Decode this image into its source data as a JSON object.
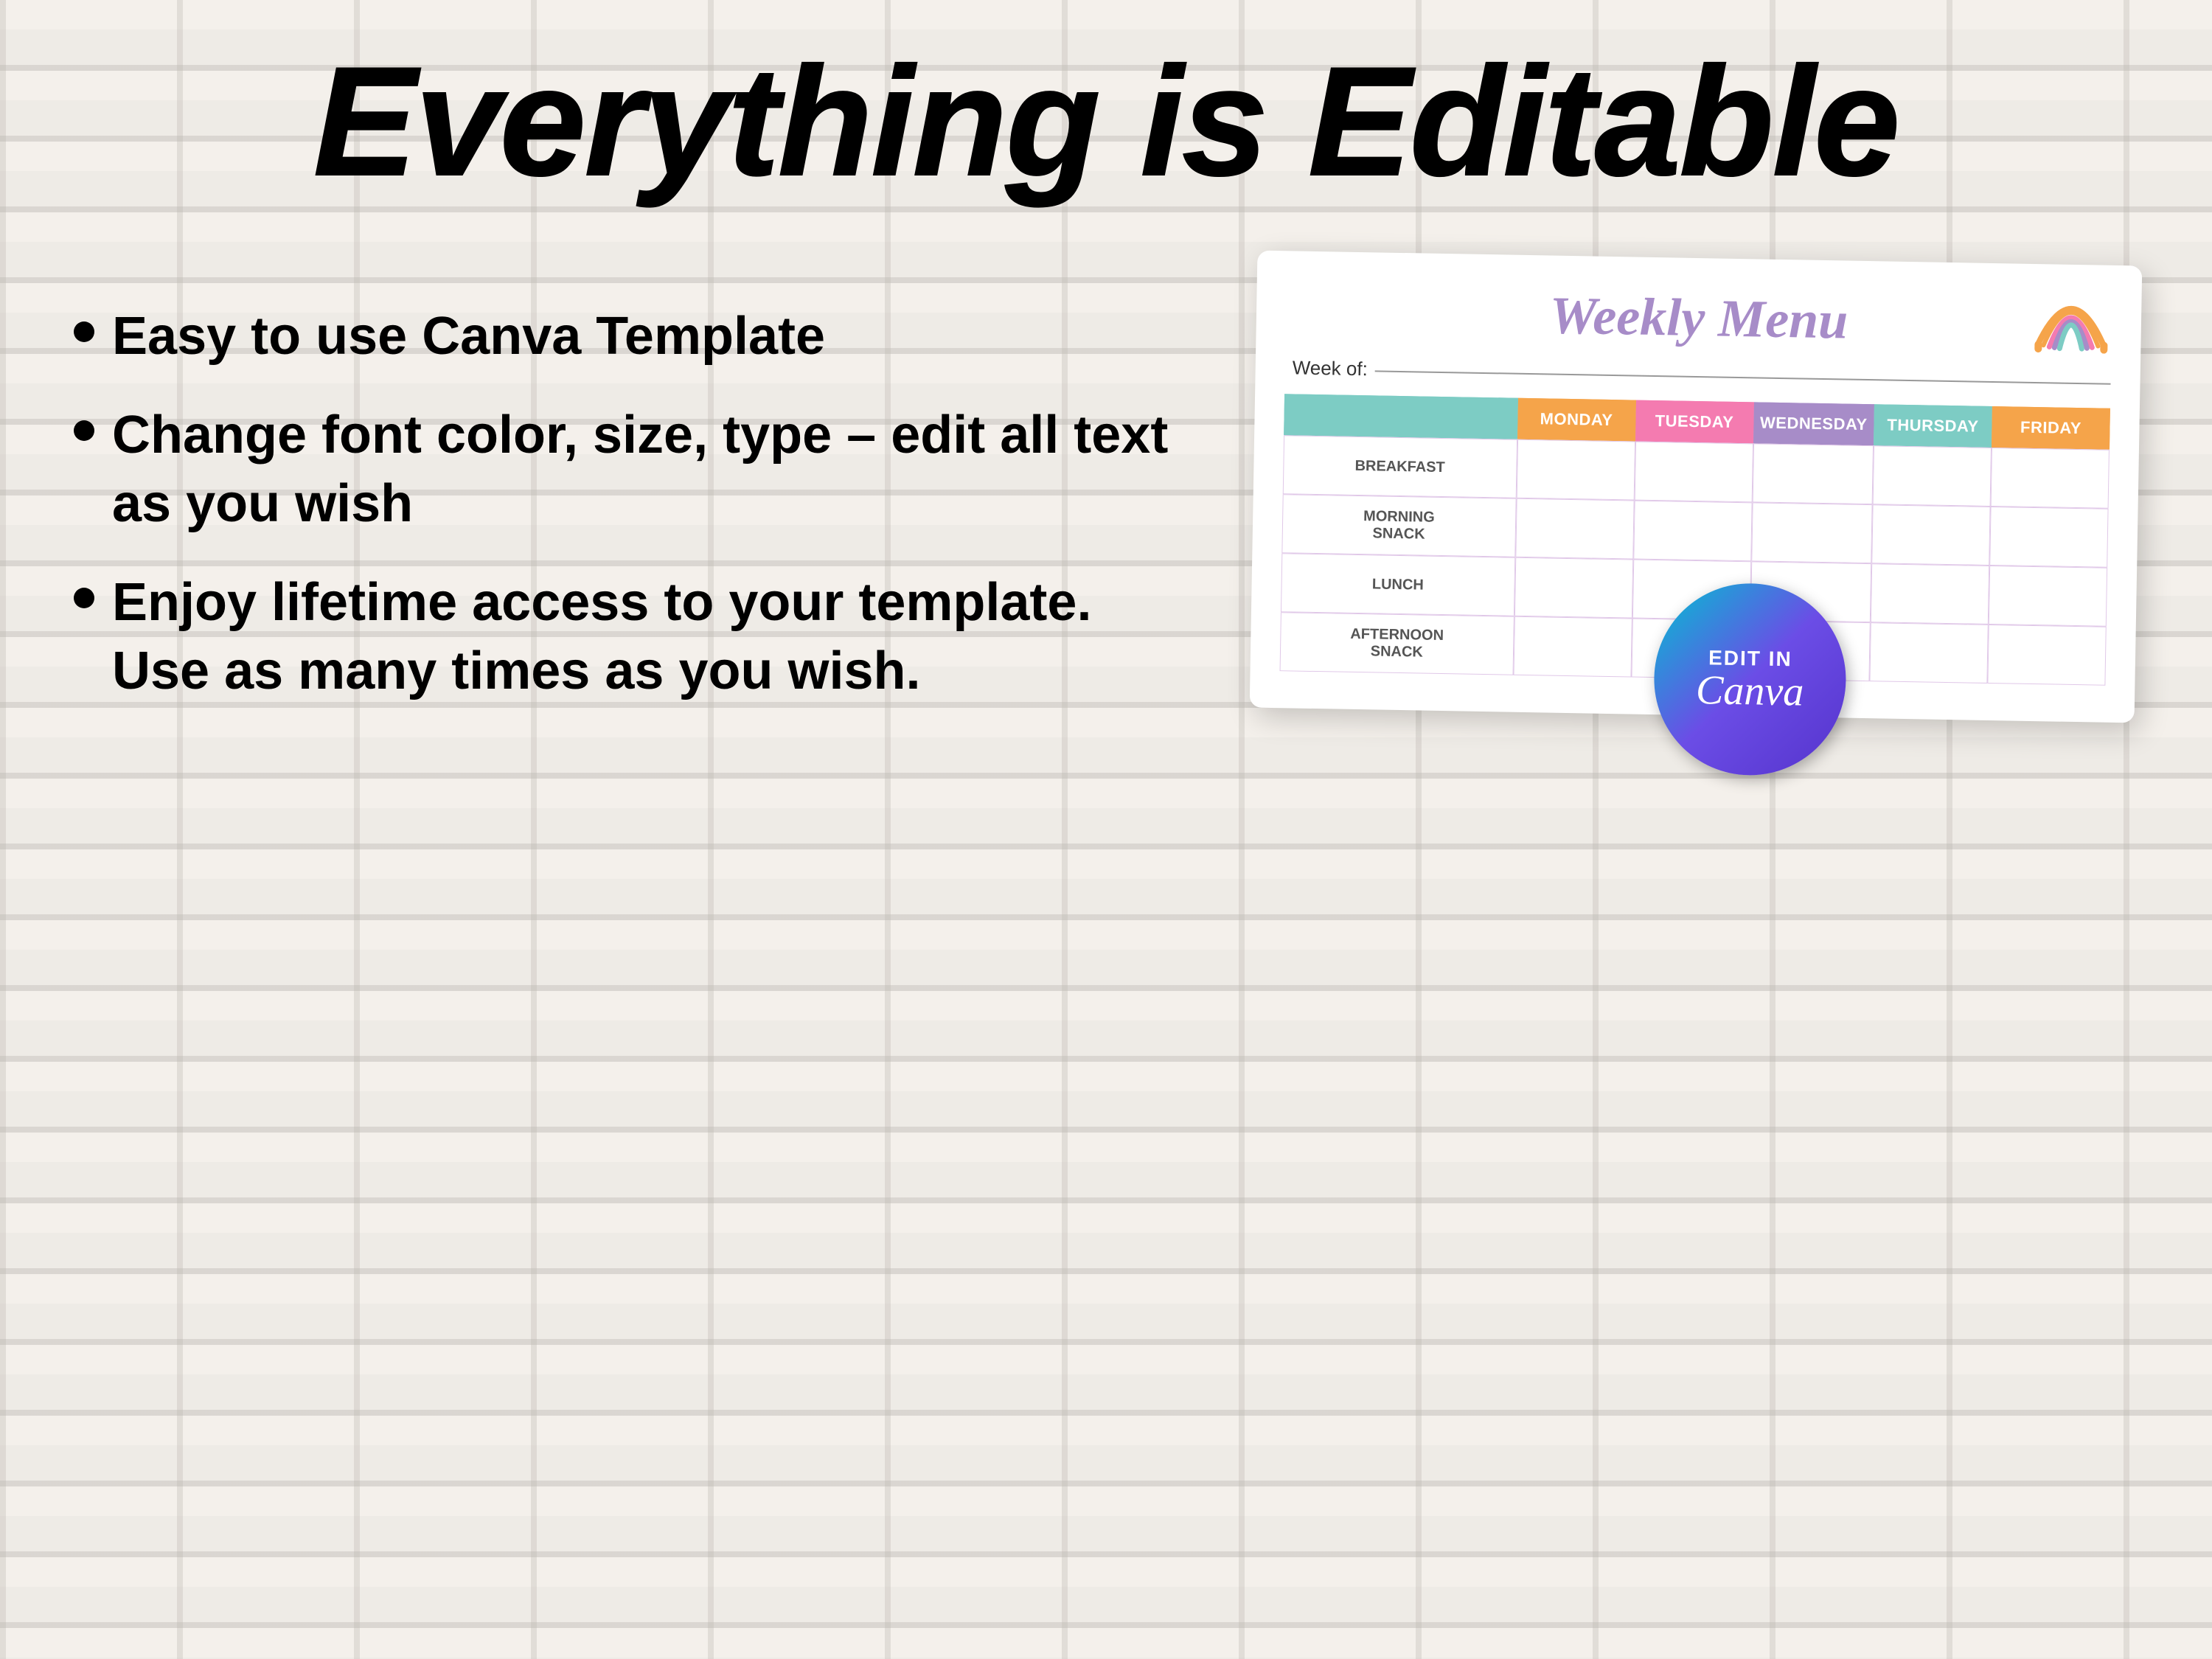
{
  "page": {
    "title": "Everything is Editable",
    "title_word1": "Everything",
    "title_is": "is",
    "title_word2": "Editable"
  },
  "bullets": [
    {
      "id": "bullet-1",
      "text": "Easy to use Canva Template"
    },
    {
      "id": "bullet-2",
      "text": " Change font color, size, type – edit all text as you wish"
    },
    {
      "id": "bullet-3",
      "text": "Enjoy lifetime access to your template. Use as many times as you wish."
    }
  ],
  "menu_card": {
    "title": "Weekly Menu",
    "week_of_label": "Week of:",
    "days": [
      "MONDAY",
      "TUESDAY",
      "WEDNESDAY",
      "THURSDAY",
      "FRIDAY"
    ],
    "rows": [
      {
        "label": "BREAKFAST"
      },
      {
        "label": "MORNING\nSNACK"
      },
      {
        "label": "LUNCH"
      },
      {
        "label": "AFTERNOON\nSNACK"
      }
    ]
  },
  "canva_badge": {
    "edit_in": "EDIT IN",
    "canva": "Canva"
  },
  "colors": {
    "teal": "#7dccc4",
    "orange": "#f5a44a",
    "pink": "#f47bb0",
    "purple": "#a78cc8",
    "title_purple": "#a78cc8"
  }
}
